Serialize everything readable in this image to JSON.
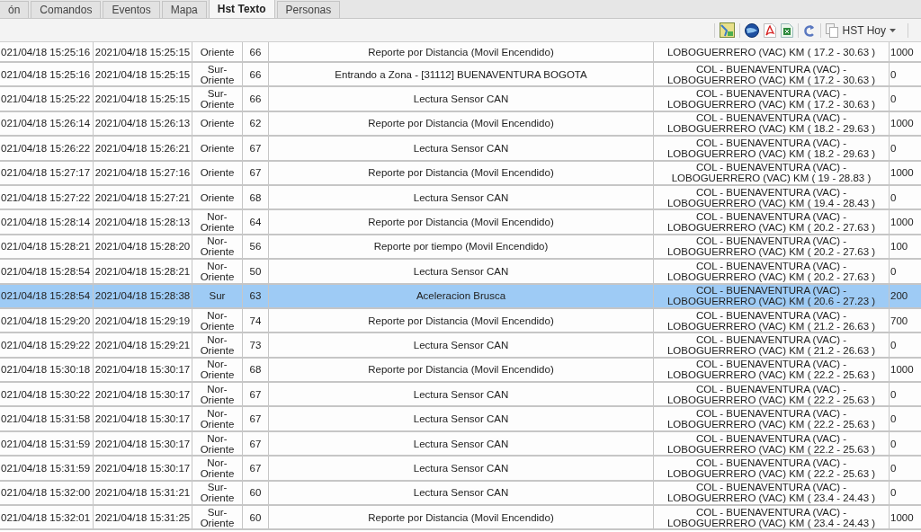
{
  "tabs": [
    {
      "label": "ón",
      "selected": false
    },
    {
      "label": "Comandos",
      "selected": false
    },
    {
      "label": "Eventos",
      "selected": false
    },
    {
      "label": "Mapa",
      "selected": false
    },
    {
      "label": "Hst Texto",
      "selected": true
    },
    {
      "label": "Personas",
      "selected": false
    }
  ],
  "toolbar": {
    "menu_button": "HST Hoy"
  },
  "table": {
    "rows": [
      {
        "selected": false,
        "cells": [
          "021/04/18 15:25:16",
          "2021/04/18 15:25:15",
          "Oriente",
          "66",
          "Reporte por Distancia (Movil Encendido)",
          "LOBOGUERRERO (VAC) KM ( 17.2 - 30.63 )",
          "1000"
        ]
      },
      {
        "selected": false,
        "cells": [
          "021/04/18 15:25:16",
          "2021/04/18 15:25:15",
          "Sur-\nOriente",
          "66",
          "Entrando a Zona - [31112] BUENAVENTURA BOGOTA",
          "COL - BUENAVENTURA (VAC) -\nLOBOGUERRERO (VAC) KM ( 17.2 - 30.63 )",
          "0"
        ]
      },
      {
        "selected": false,
        "cells": [
          "021/04/18 15:25:22",
          "2021/04/18 15:25:15",
          "Sur-\nOriente",
          "66",
          "Lectura Sensor CAN",
          "COL - BUENAVENTURA (VAC) -\nLOBOGUERRERO (VAC) KM ( 17.2 - 30.63 )",
          "0"
        ]
      },
      {
        "selected": false,
        "cells": [
          "021/04/18 15:26:14",
          "2021/04/18 15:26:13",
          "Oriente",
          "62",
          "Reporte por Distancia (Movil Encendido)",
          "COL - BUENAVENTURA (VAC) -\nLOBOGUERRERO (VAC) KM ( 18.2 - 29.63 )",
          "1000"
        ]
      },
      {
        "selected": false,
        "cells": [
          "021/04/18 15:26:22",
          "2021/04/18 15:26:21",
          "Oriente",
          "67",
          "Lectura Sensor CAN",
          "COL - BUENAVENTURA (VAC) -\nLOBOGUERRERO (VAC) KM ( 18.2 - 29.63 )",
          "0"
        ]
      },
      {
        "selected": false,
        "cells": [
          "021/04/18 15:27:17",
          "2021/04/18 15:27:16",
          "Oriente",
          "67",
          "Reporte por Distancia (Movil Encendido)",
          "COL - BUENAVENTURA (VAC) -\nLOBOGUERRERO (VAC) KM ( 19 - 28.83 )",
          "1000"
        ]
      },
      {
        "selected": false,
        "cells": [
          "021/04/18 15:27:22",
          "2021/04/18 15:27:21",
          "Oriente",
          "68",
          "Lectura Sensor CAN",
          "COL - BUENAVENTURA (VAC) -\nLOBOGUERRERO (VAC) KM ( 19.4 - 28.43 )",
          "0"
        ]
      },
      {
        "selected": false,
        "cells": [
          "021/04/18 15:28:14",
          "2021/04/18 15:28:13",
          "Nor-\nOriente",
          "64",
          "Reporte por Distancia (Movil Encendido)",
          "COL - BUENAVENTURA (VAC) -\nLOBOGUERRERO (VAC) KM ( 20.2 - 27.63 )",
          "1000"
        ]
      },
      {
        "selected": false,
        "cells": [
          "021/04/18 15:28:21",
          "2021/04/18 15:28:20",
          "Nor-\nOriente",
          "56",
          "Reporte por tiempo (Movil Encendido)",
          "COL - BUENAVENTURA (VAC) -\nLOBOGUERRERO (VAC) KM ( 20.2 - 27.63 )",
          "100"
        ]
      },
      {
        "selected": false,
        "cells": [
          "021/04/18 15:28:54",
          "2021/04/18 15:28:21",
          "Nor-\nOriente",
          "50",
          "Lectura Sensor CAN",
          "COL - BUENAVENTURA (VAC) -\nLOBOGUERRERO (VAC) KM ( 20.2 - 27.63 )",
          "0"
        ]
      },
      {
        "selected": true,
        "cells": [
          "021/04/18 15:28:54",
          "2021/04/18 15:28:38",
          "Sur",
          "63",
          "Aceleracion Brusca",
          "COL - BUENAVENTURA (VAC) -\nLOBOGUERRERO (VAC) KM ( 20.6 - 27.23 )",
          "200"
        ]
      },
      {
        "selected": false,
        "cells": [
          "021/04/18 15:29:20",
          "2021/04/18 15:29:19",
          "Nor-\nOriente",
          "74",
          "Reporte por Distancia (Movil Encendido)",
          "COL - BUENAVENTURA (VAC) -\nLOBOGUERRERO (VAC) KM ( 21.2 - 26.63 )",
          "700"
        ]
      },
      {
        "selected": false,
        "cells": [
          "021/04/18 15:29:22",
          "2021/04/18 15:29:21",
          "Nor-\nOriente",
          "73",
          "Lectura Sensor CAN",
          "COL - BUENAVENTURA (VAC) -\nLOBOGUERRERO (VAC) KM ( 21.2 - 26.63 )",
          "0"
        ]
      },
      {
        "selected": false,
        "cells": [
          "021/04/18 15:30:18",
          "2021/04/18 15:30:17",
          "Nor-\nOriente",
          "68",
          "Reporte por Distancia (Movil Encendido)",
          "COL - BUENAVENTURA (VAC) -\nLOBOGUERRERO (VAC) KM ( 22.2 - 25.63 )",
          "1000"
        ]
      },
      {
        "selected": false,
        "cells": [
          "021/04/18 15:30:22",
          "2021/04/18 15:30:17",
          "Nor-\nOriente",
          "67",
          "Lectura Sensor CAN",
          "COL - BUENAVENTURA (VAC) -\nLOBOGUERRERO (VAC) KM ( 22.2 - 25.63 )",
          "0"
        ]
      },
      {
        "selected": false,
        "cells": [
          "021/04/18 15:31:58",
          "2021/04/18 15:30:17",
          "Nor-\nOriente",
          "67",
          "Lectura Sensor CAN",
          "COL - BUENAVENTURA (VAC) -\nLOBOGUERRERO (VAC) KM ( 22.2 - 25.63 )",
          "0"
        ]
      },
      {
        "selected": false,
        "cells": [
          "021/04/18 15:31:59",
          "2021/04/18 15:30:17",
          "Nor-\nOriente",
          "67",
          "Lectura Sensor CAN",
          "COL - BUENAVENTURA (VAC) -\nLOBOGUERRERO (VAC) KM ( 22.2 - 25.63 )",
          "0"
        ]
      },
      {
        "selected": false,
        "cells": [
          "021/04/18 15:31:59",
          "2021/04/18 15:30:17",
          "Nor-\nOriente",
          "67",
          "Lectura Sensor CAN",
          "COL - BUENAVENTURA (VAC) -\nLOBOGUERRERO (VAC) KM ( 22.2 - 25.63 )",
          "0"
        ]
      },
      {
        "selected": false,
        "cells": [
          "021/04/18 15:32:00",
          "2021/04/18 15:31:21",
          "Sur-\nOriente",
          "60",
          "Lectura Sensor CAN",
          "COL - BUENAVENTURA (VAC) -\nLOBOGUERRERO (VAC) KM ( 23.4 - 24.43 )",
          "0"
        ]
      },
      {
        "selected": false,
        "cells": [
          "021/04/18 15:32:01",
          "2021/04/18 15:31:25",
          "Sur-\nOriente",
          "60",
          "Reporte por Distancia (Movil Encendido)",
          "COL - BUENAVENTURA (VAC) -\nLOBOGUERRERO (VAC) KM ( 23.4 - 24.43 )",
          "1000"
        ]
      }
    ]
  }
}
